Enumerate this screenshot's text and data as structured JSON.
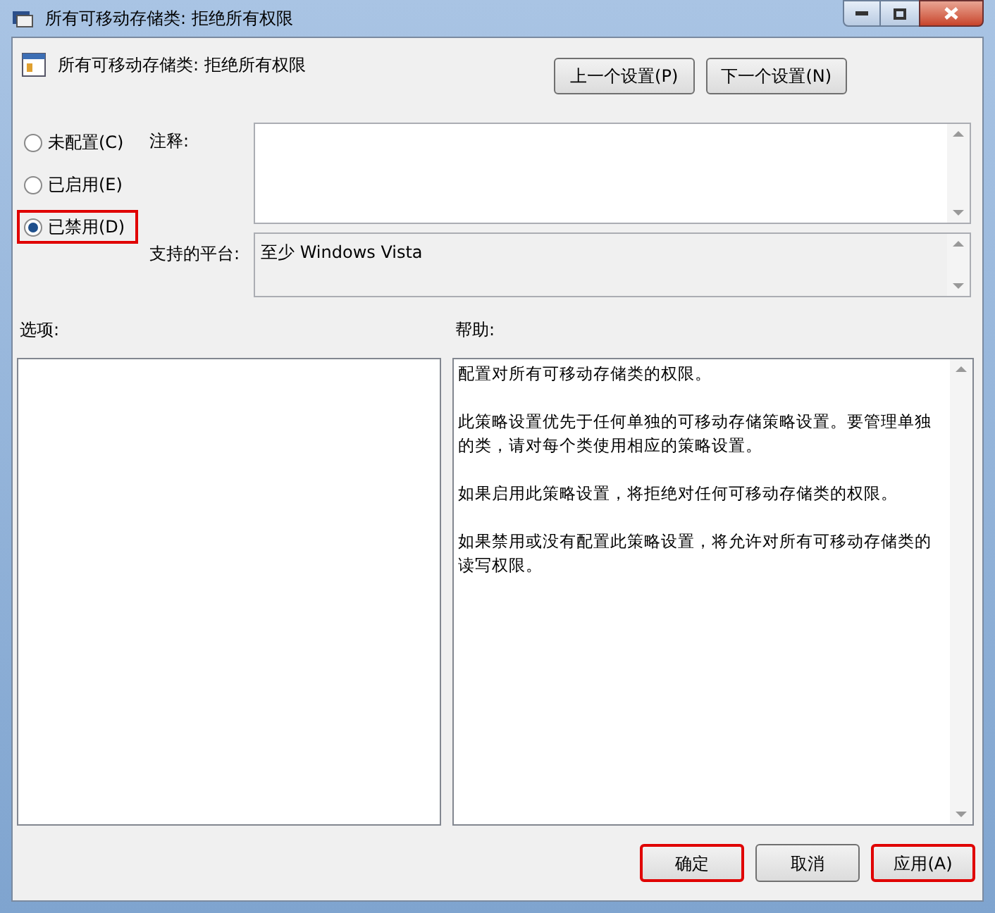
{
  "window": {
    "title": "所有可移动存储类: 拒绝所有权限"
  },
  "header": {
    "title": "所有可移动存储类: 拒绝所有权限",
    "nav_buttons": [
      "上一个设置(P)",
      "下一个设置(N)"
    ]
  },
  "options": [
    {
      "label": "未配置(C)",
      "selected": false,
      "highlighted": false
    },
    {
      "label": "已启用(E)",
      "selected": false,
      "highlighted": false
    },
    {
      "label": "已禁用(D)",
      "selected": true,
      "highlighted": true
    }
  ],
  "comment": {
    "label": "注释:"
  },
  "platform": {
    "label": "支持的平台:",
    "value": "至少 Windows Vista"
  },
  "options_panel": {
    "label": "选项:"
  },
  "help": {
    "label": "帮助:",
    "paragraphs": [
      "配置对所有可移动存储类的权限。",
      "此策略设置优先于任何单独的可移动存储策略设置。要管理单独的类，请对每个类使用相应的策略设置。",
      "如果启用此策略设置，将拒绝对任何可移动存储类的权限。",
      "如果禁用或没有配置此策略设置，将允许对所有可移动存储类的读写权限。"
    ]
  },
  "buttons": [
    {
      "label": "确定",
      "highlighted": true
    },
    {
      "label": "取消",
      "highlighted": false
    },
    {
      "label": "应用(A)",
      "highlighted": true
    }
  ]
}
